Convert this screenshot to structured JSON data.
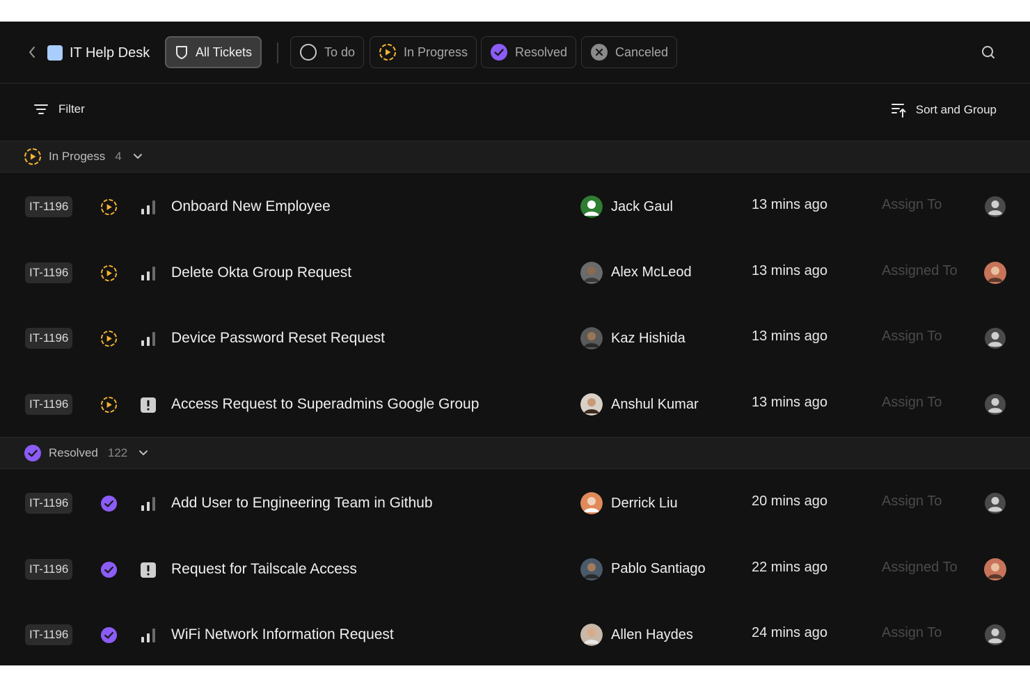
{
  "header": {
    "app_title": "IT Help Desk",
    "app_color": "#a9cdfc",
    "tabs": [
      {
        "label": "All Tickets",
        "icon": "shield-icon",
        "active": true
      },
      {
        "label": "To do",
        "icon": "circle-icon"
      },
      {
        "label": "In Progress",
        "icon": "in-progress-icon"
      },
      {
        "label": "Resolved",
        "icon": "check-circle-icon"
      },
      {
        "label": "Canceled",
        "icon": "x-circle-icon"
      }
    ]
  },
  "toolbar": {
    "filter_label": "Filter",
    "sort_label": "Sort and Group"
  },
  "groups": [
    {
      "label": "In Progess",
      "count": "4",
      "status": "in-progress",
      "color": "#f5b430"
    },
    {
      "label": "Resolved",
      "count": "122",
      "status": "resolved",
      "color": "#8b5cf6"
    }
  ],
  "in_progress_tickets": [
    {
      "id": "IT-1196",
      "title": "Onboard New Employee",
      "priority": "bars",
      "assignee": "Jack Gaul",
      "time": "13 mins ago",
      "assign_label": "Assign To"
    },
    {
      "id": "IT-1196",
      "title": "Delete Okta Group Request",
      "priority": "bars",
      "assignee": "Alex McLeod",
      "time": "13 mins ago",
      "assign_label": "Assigned To"
    },
    {
      "id": "IT-1196",
      "title": "Device Password Reset Request",
      "priority": "bars",
      "assignee": "Kaz Hishida",
      "time": "13 mins ago",
      "assign_label": "Assign To"
    },
    {
      "id": "IT-1196",
      "title": "Access Request to Superadmins Google Group",
      "priority": "urgent",
      "assignee": "Anshul Kumar",
      "time": "13 mins ago",
      "assign_label": "Assign To"
    }
  ],
  "resolved_tickets": [
    {
      "id": "IT-1196",
      "title": "Add User to Engineering Team in Github",
      "priority": "bars",
      "assignee": "Derrick Liu",
      "time": "20 mins ago",
      "assign_label": "Assign To"
    },
    {
      "id": "IT-1196",
      "title": "Request for Tailscale Access",
      "priority": "urgent",
      "assignee": "Pablo Santiago",
      "time": "22 mins ago",
      "assign_label": "Assigned To"
    },
    {
      "id": "IT-1196",
      "title": "WiFi Network Information Request",
      "priority": "bars",
      "assignee": "Allen Haydes",
      "time": "24 mins ago",
      "assign_label": "Assign To"
    }
  ]
}
